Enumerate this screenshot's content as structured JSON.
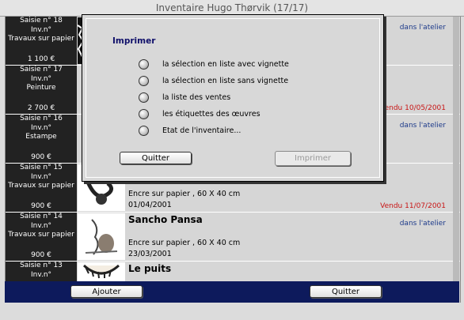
{
  "window": {
    "title": "Inventaire Hugo Thørvik (17/17)"
  },
  "rows": [
    {
      "saisie": "Saisie n° 18",
      "inv": "Inv.n°",
      "type": "Travaux sur papier",
      "price": "1 100 €",
      "title": "",
      "desc": "",
      "date": "",
      "status": "dans l'atelier",
      "status_color": "navy"
    },
    {
      "saisie": "Saisie n° 17",
      "inv": "Inv.n°",
      "type": "Peinture",
      "price": "2 700 €",
      "title": "",
      "desc": "",
      "date": "",
      "status": "Vendu 10/05/2001",
      "status_color": "red"
    },
    {
      "saisie": "Saisie n° 16",
      "inv": "Inv.n°",
      "type": "Estampe",
      "price": "900 €",
      "title": "",
      "desc": "",
      "date": "",
      "status": "dans l'atelier",
      "status_color": "navy"
    },
    {
      "saisie": "Saisie n° 15",
      "inv": "Inv.n°",
      "type": "Travaux sur papier",
      "price": "900 €",
      "title": "",
      "desc": "Encre sur papier , 60 X 40 cm",
      "date": "01/04/2001",
      "status": "Vendu 11/07/2001",
      "status_color": "red"
    },
    {
      "saisie": "Saisie n° 14",
      "inv": "Inv.n°",
      "type": "Travaux sur papier",
      "price": "900 €",
      "title": "Sancho Pansa",
      "desc": "Encre sur papier , 60 X 40 cm",
      "date": "23/03/2001",
      "status": "dans l'atelier",
      "status_color": "navy"
    },
    {
      "saisie": "Saisie n° 13",
      "inv": "Inv.n°",
      "type": "",
      "price": "",
      "title": "Le puits",
      "desc": "",
      "date": "",
      "status": "",
      "status_color": "navy"
    }
  ],
  "bottom": {
    "add_label": "Ajouter",
    "quit_label": "Quitter"
  },
  "dialog": {
    "title": "Imprimer",
    "options": [
      "la sélection en liste avec vignette",
      "la sélection en liste sans vignette",
      "la liste des ventes",
      "les étiquettes des œuvres",
      "Etat de l'inventaire..."
    ],
    "quit_label": "Quitter",
    "print_label": "Imprimer"
  },
  "colors": {
    "navy": "#0d1a5c",
    "status_red": "#c81414",
    "status_navy": "#1d3a8a"
  },
  "icons": [
    "radio-button",
    "mouse-pointer-icon"
  ]
}
